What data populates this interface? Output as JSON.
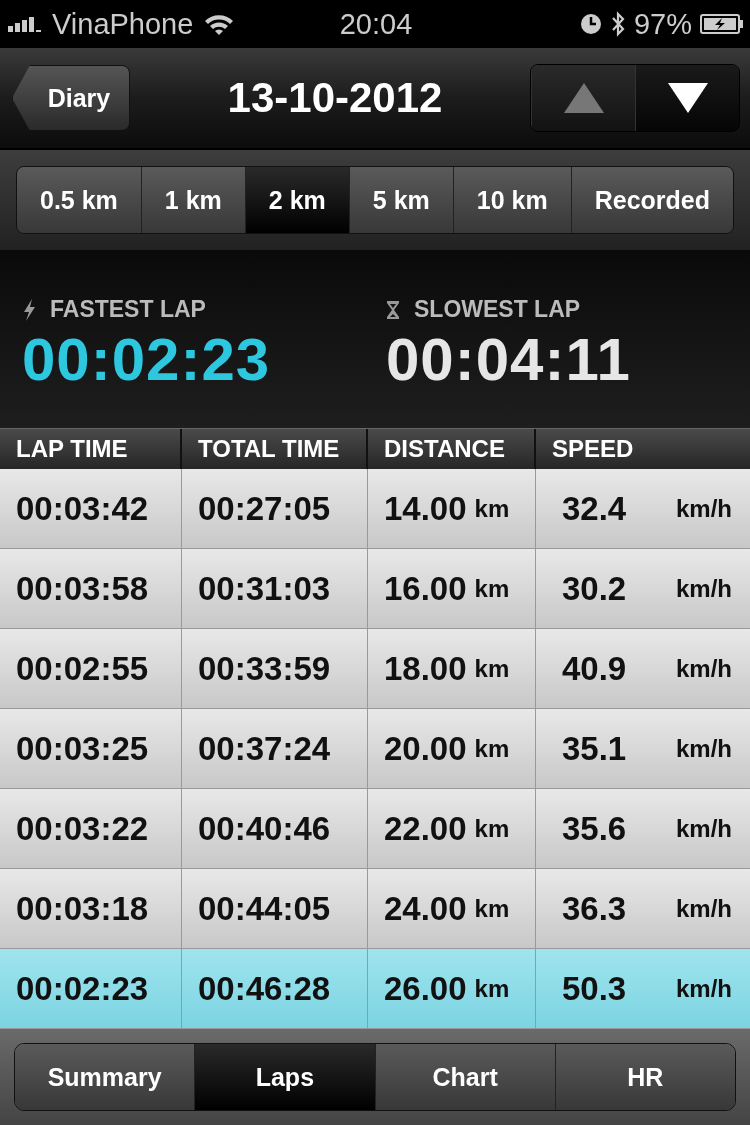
{
  "status_bar": {
    "carrier": "VinaPhone",
    "time": "20:04",
    "battery": "97%"
  },
  "nav": {
    "back": "Diary",
    "title": "13-10-2012",
    "arrows": [
      {
        "kind": "up",
        "disabled": true
      },
      {
        "kind": "down",
        "disabled": false
      }
    ]
  },
  "distance_tabs": [
    {
      "label": "0.5 km",
      "selected": false
    },
    {
      "label": "1 km",
      "selected": false
    },
    {
      "label": "2 km",
      "selected": true
    },
    {
      "label": "5 km",
      "selected": false
    },
    {
      "label": "10 km",
      "selected": false
    },
    {
      "label": "Recorded",
      "selected": false
    }
  ],
  "stats": [
    {
      "kind": "fastest",
      "label": "FASTEST LAP",
      "value": "00:02:23"
    },
    {
      "kind": "slowest",
      "label": "SLOWEST LAP",
      "value": "00:04:11"
    }
  ],
  "table": {
    "columns": [
      "LAP TIME",
      "TOTAL TIME",
      "DISTANCE",
      "SPEED"
    ],
    "rows": [
      {
        "lap": "00:03:42",
        "total": "00:27:05",
        "distance": "14.00",
        "distance_unit": "km",
        "speed": "32.4",
        "speed_unit": "km/h",
        "selected": false
      },
      {
        "lap": "00:03:58",
        "total": "00:31:03",
        "distance": "16.00",
        "distance_unit": "km",
        "speed": "30.2",
        "speed_unit": "km/h",
        "selected": false
      },
      {
        "lap": "00:02:55",
        "total": "00:33:59",
        "distance": "18.00",
        "distance_unit": "km",
        "speed": "40.9",
        "speed_unit": "km/h",
        "selected": false
      },
      {
        "lap": "00:03:25",
        "total": "00:37:24",
        "distance": "20.00",
        "distance_unit": "km",
        "speed": "35.1",
        "speed_unit": "km/h",
        "selected": false
      },
      {
        "lap": "00:03:22",
        "total": "00:40:46",
        "distance": "22.00",
        "distance_unit": "km",
        "speed": "35.6",
        "speed_unit": "km/h",
        "selected": false
      },
      {
        "lap": "00:03:18",
        "total": "00:44:05",
        "distance": "24.00",
        "distance_unit": "km",
        "speed": "36.3",
        "speed_unit": "km/h",
        "selected": false
      },
      {
        "lap": "00:02:23",
        "total": "00:46:28",
        "distance": "26.00",
        "distance_unit": "km",
        "speed": "50.3",
        "speed_unit": "km/h",
        "selected": true
      }
    ]
  },
  "bottom_tabs": [
    {
      "label": "Summary",
      "selected": false
    },
    {
      "label": "Laps",
      "selected": true
    },
    {
      "label": "Chart",
      "selected": false
    },
    {
      "label": "HR",
      "selected": false
    }
  ]
}
